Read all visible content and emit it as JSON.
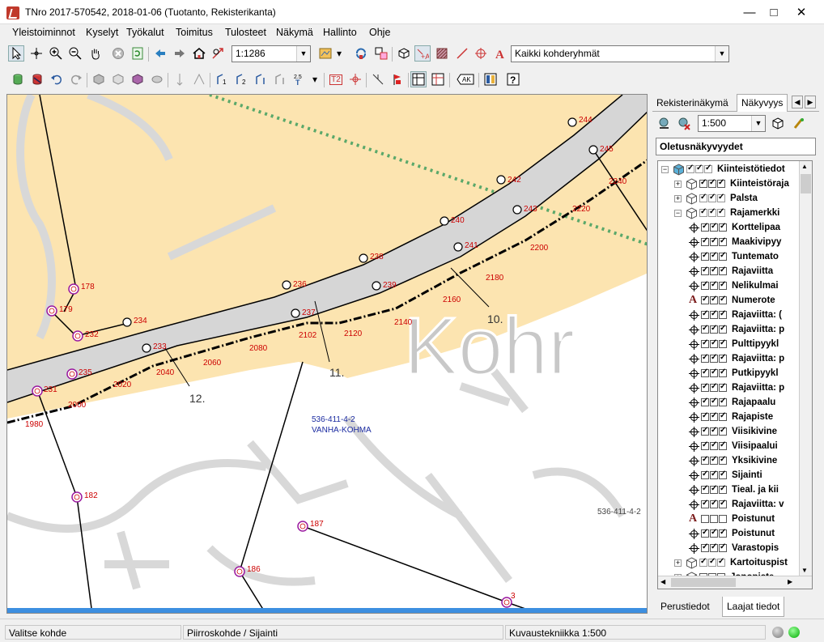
{
  "window": {
    "title": "TNro 2017-570542, 2018-01-06 (Tuotanto, Rekisterikanta)",
    "minimize": "—",
    "maximize": "□",
    "close": "✕"
  },
  "menu": [
    "Yleistoiminnot",
    "Kyselyt",
    "Työkalut",
    "Toimitus",
    "Tulosteet",
    "Näkymä",
    "Hallinto",
    "Ohje"
  ],
  "toolbar1": {
    "scale_value": "1:1286",
    "group_value": "Kaikki kohderyhmät"
  },
  "toolbar2": {
    "label_t2": "T2",
    "label_ak": "AK",
    "label_scale_small": "2.5"
  },
  "map": {
    "watermark": "Kohr",
    "parcel_label_1": "536-411-4-2",
    "parcel_name_1": "VANHA-KOHMA",
    "parcel_label_2": "536-411-4-2",
    "points": [
      {
        "id": "244"
      },
      {
        "id": "245"
      },
      {
        "id": "242"
      },
      {
        "id": "243"
      },
      {
        "id": "240"
      },
      {
        "id": "241"
      },
      {
        "id": "238"
      },
      {
        "id": "239"
      },
      {
        "id": "236"
      },
      {
        "id": "237"
      },
      {
        "id": "234"
      },
      {
        "id": "233"
      },
      {
        "id": "232"
      },
      {
        "id": "235"
      },
      {
        "id": "231"
      },
      {
        "id": "178"
      },
      {
        "id": "179"
      },
      {
        "id": "182"
      },
      {
        "id": "187"
      },
      {
        "id": "186"
      },
      {
        "id": "3"
      }
    ],
    "chainage": [
      "2240",
      "2220",
      "2200",
      "2180",
      "2160",
      "2140",
      "2120",
      "2102",
      "2080",
      "2060",
      "2040",
      "2020",
      "2000",
      "1980"
    ],
    "line_numbers": [
      "10.",
      "11.",
      "12."
    ]
  },
  "panel": {
    "tab1": "Rekisterinäkymä",
    "tab2": "Näkyvyys",
    "scale": "1:500",
    "view_combo": "Oletusnäkyvyydet",
    "bottom_tab1": "Perustiedot",
    "bottom_tab2": "Laajat tiedot",
    "tree": [
      {
        "label": "Kiinteistötiedot",
        "level": 0,
        "expander": "−",
        "checks": "gray3"
      },
      {
        "label": "Kiinteistöraja",
        "level": 1,
        "expander": "+",
        "checks": "on3"
      },
      {
        "label": "Palsta",
        "level": 1,
        "expander": "+",
        "checks": "gray3"
      },
      {
        "label": "Rajamerkki",
        "level": 1,
        "expander": "−",
        "checks": "gray3"
      },
      {
        "label": "Korttelipaa",
        "level": 2,
        "checks": "on3"
      },
      {
        "label": "Maakivipyy",
        "level": 2,
        "checks": "on3"
      },
      {
        "label": "Tuntemato",
        "level": 2,
        "checks": "on3"
      },
      {
        "label": "Rajaviitta",
        "level": 2,
        "checks": "on3"
      },
      {
        "label": "Nelikulmai",
        "level": 2,
        "checks": "on3"
      },
      {
        "label": "Numerote",
        "level": 2,
        "checks": "on3",
        "text_icon": true
      },
      {
        "label": "Rajaviitta: (",
        "level": 2,
        "checks": "on3"
      },
      {
        "label": "Rajaviitta: p",
        "level": 2,
        "checks": "on3"
      },
      {
        "label": "Pulttipyykl",
        "level": 2,
        "checks": "on3"
      },
      {
        "label": "Rajaviitta: p",
        "level": 2,
        "checks": "on3"
      },
      {
        "label": "Putkipyykl",
        "level": 2,
        "checks": "on3"
      },
      {
        "label": "Rajaviitta: p",
        "level": 2,
        "checks": "on3"
      },
      {
        "label": "Rajapaalu",
        "level": 2,
        "checks": "on3"
      },
      {
        "label": "Rajapiste",
        "level": 2,
        "checks": "on3"
      },
      {
        "label": "Viisikivine",
        "level": 2,
        "checks": "on3"
      },
      {
        "label": "Viisipaalui",
        "level": 2,
        "checks": "on3"
      },
      {
        "label": "Yksikivine",
        "level": 2,
        "checks": "on3"
      },
      {
        "label": "Sijainti",
        "level": 2,
        "checks": "on3"
      },
      {
        "label": "Tieal. ja kii",
        "level": 2,
        "checks": "on3"
      },
      {
        "label": "Rajaviitta: v",
        "level": 2,
        "checks": "on3"
      },
      {
        "label": "Poistunut",
        "level": 2,
        "checks": "off3",
        "text_icon": true
      },
      {
        "label": "Poistunut",
        "level": 2,
        "checks": "on3"
      },
      {
        "label": "Varastopis",
        "level": 2,
        "checks": "on3"
      },
      {
        "label": "Kartoituspist",
        "level": 1,
        "expander": "+",
        "checks": "gray3"
      },
      {
        "label": "Jonopiste",
        "level": 1,
        "expander": "+",
        "checks": "off3"
      }
    ]
  },
  "status": {
    "left": "Valitse kohde",
    "middle": "Piirroskohde / Sijainti",
    "right": "Kuvaustekniikka 1:500"
  },
  "colors": {
    "land": "#fce4b0",
    "road": "#d6d6d6",
    "boundary": "#000000",
    "point_red": "#cc0000",
    "point_purple": "#9b1aa0",
    "green_dotted": "#5aa86a",
    "watermark": "#c8c8c8"
  }
}
